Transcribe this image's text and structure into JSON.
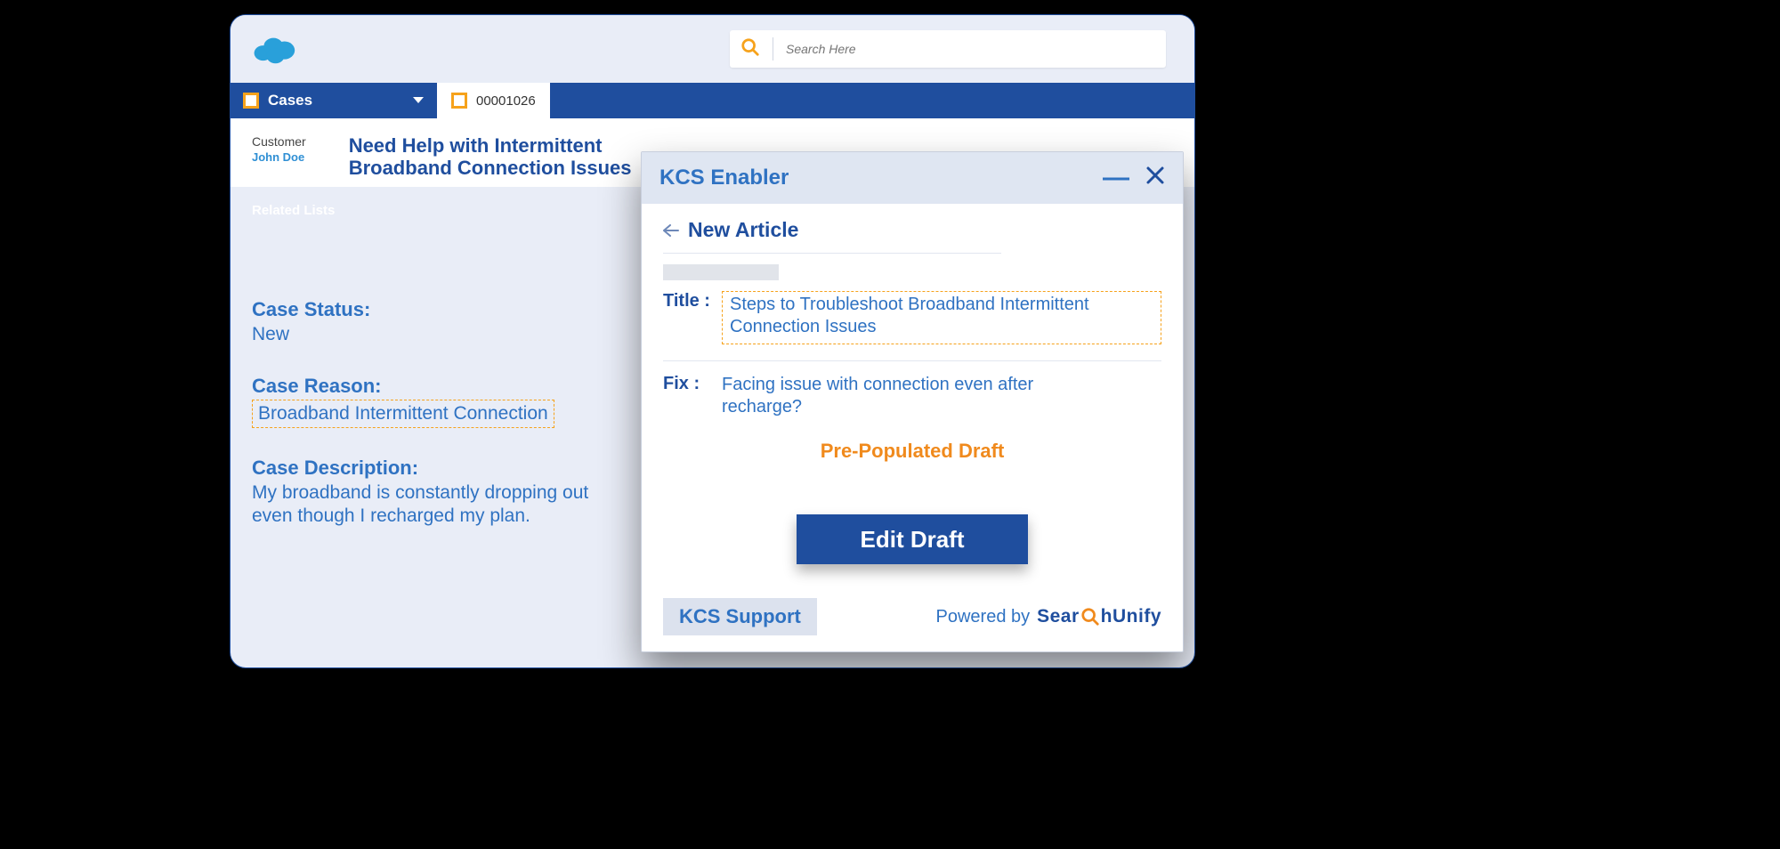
{
  "header": {
    "search_placeholder": "Search Here"
  },
  "nav": {
    "cases_label": "Cases",
    "tab_number": "00001026"
  },
  "customer": {
    "label": "Customer",
    "name": "John Doe"
  },
  "case": {
    "title": "Need Help with Intermittent Broadband Connection Issues",
    "related_lists_label": "Related Lists",
    "status_label": "Case Status:",
    "status_value": "New",
    "reason_label": "Case Reason:",
    "reason_value": "Broadband Intermittent Connection",
    "description_label": "Case Description:",
    "description_value": "My broadband is constantly  dropping out even though I recharged my plan."
  },
  "kcs": {
    "panel_title": "KCS Enabler",
    "new_article": "New Article",
    "title_label": "Title :",
    "title_value": "Steps to Troubleshoot Broadband Intermittent Connection Issues",
    "fix_label": "Fix :",
    "fix_value": "Facing issue with connection even after recharge?",
    "prepopulated": "Pre-Populated Draft",
    "edit_button": "Edit Draft",
    "support_button": "KCS Support",
    "powered_by": "Powered by",
    "brand_left": "Sear",
    "brand_right": "hUnify"
  }
}
